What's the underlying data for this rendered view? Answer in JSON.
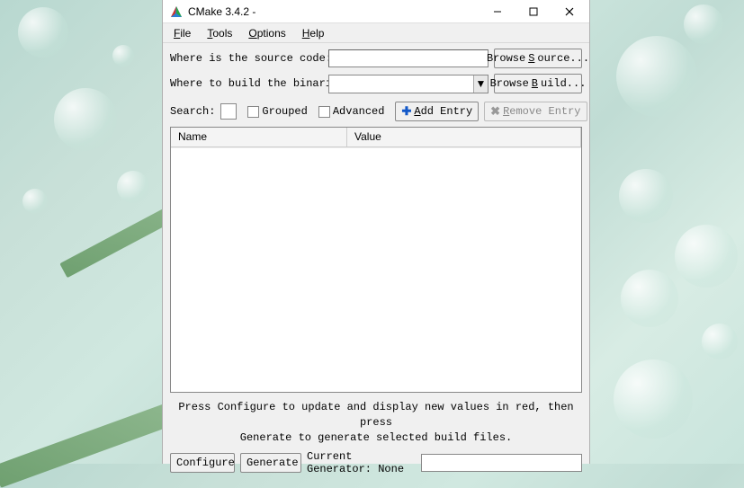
{
  "window": {
    "title": "CMake 3.4.2  -"
  },
  "menu": {
    "file": "File",
    "tools": "Tools",
    "options": "Options",
    "help": "Help"
  },
  "rows": {
    "source_label": "Where is the source code:",
    "source_value": "",
    "browse_source": "Browse Source...",
    "build_label": "Where to build the binaries:",
    "build_value": "",
    "browse_build": "Browse Build..."
  },
  "search": {
    "label": "Search:",
    "grouped": "Grouped",
    "advanced": "Advanced",
    "add_entry": "Add Entry",
    "remove_entry": "Remove Entry"
  },
  "table": {
    "col_name": "Name",
    "col_value": "Value",
    "rows": []
  },
  "hint": {
    "line1": "Press Configure to update and display new values in red,  then press",
    "line2": "Generate to generate selected build files."
  },
  "bottom": {
    "configure": "Configure",
    "generate": "Generate",
    "current_gen_label": "Current Generator: None"
  }
}
